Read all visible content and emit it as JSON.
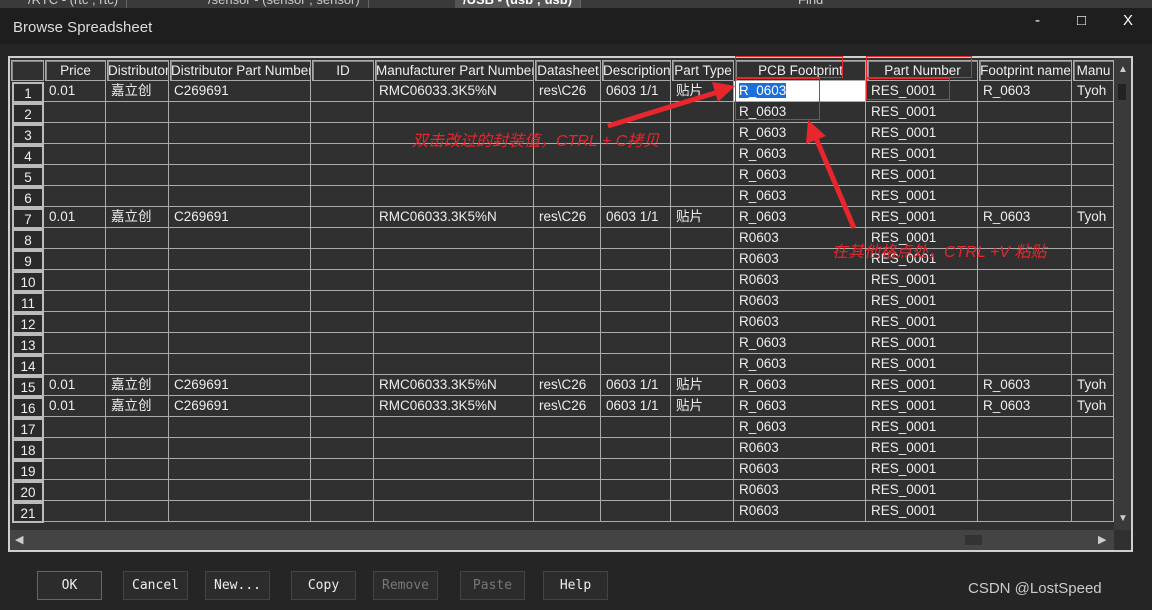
{
  "tabs": [
    "/RTC - (rtc ; rtc)",
    "/sensor - (sensor ; sensor)",
    "/USB - (usb ; usb)",
    "Find"
  ],
  "window": {
    "title": "Browse Spreadsheet",
    "minimize": "-",
    "maximize": "□",
    "close": "X"
  },
  "columns": [
    "",
    "Price",
    "Distributor",
    "Distributor Part Number",
    "ID",
    "Manufacturer Part Number",
    "Datasheet",
    "Description",
    "Part Type",
    "PCB Footprint",
    "Part Number",
    "Footprint name",
    "Manu"
  ],
  "rows": [
    [
      "1",
      "0.01",
      "嘉立创",
      "C269691",
      "",
      "RMC06033.3K5%N",
      "res\\C26",
      "0603 1/1",
      "贴片",
      "R_0603",
      "RES_0001",
      "R_0603",
      "Tyoh"
    ],
    [
      "2",
      "",
      "",
      "",
      "",
      "",
      "",
      "",
      "",
      "R_0603",
      "RES_0001",
      "",
      ""
    ],
    [
      "3",
      "",
      "",
      "",
      "",
      "",
      "",
      "",
      "",
      "R_0603",
      "RES_0001",
      "",
      ""
    ],
    [
      "4",
      "",
      "",
      "",
      "",
      "",
      "",
      "",
      "",
      "R_0603",
      "RES_0001",
      "",
      ""
    ],
    [
      "5",
      "",
      "",
      "",
      "",
      "",
      "",
      "",
      "",
      "R_0603",
      "RES_0001",
      "",
      ""
    ],
    [
      "6",
      "",
      "",
      "",
      "",
      "",
      "",
      "",
      "",
      "R_0603",
      "RES_0001",
      "",
      ""
    ],
    [
      "7",
      "0.01",
      "嘉立创",
      "C269691",
      "",
      "RMC06033.3K5%N",
      "res\\C26",
      "0603 1/1",
      "贴片",
      "R_0603",
      "RES_0001",
      "R_0603",
      "Tyoh"
    ],
    [
      "8",
      "",
      "",
      "",
      "",
      "",
      "",
      "",
      "",
      "R0603",
      "RES_0001",
      "",
      ""
    ],
    [
      "9",
      "",
      "",
      "",
      "",
      "",
      "",
      "",
      "",
      "R0603",
      "RES_0001",
      "",
      ""
    ],
    [
      "10",
      "",
      "",
      "",
      "",
      "",
      "",
      "",
      "",
      "R0603",
      "RES_0001",
      "",
      ""
    ],
    [
      "11",
      "",
      "",
      "",
      "",
      "",
      "",
      "",
      "",
      "R0603",
      "RES_0001",
      "",
      ""
    ],
    [
      "12",
      "",
      "",
      "",
      "",
      "",
      "",
      "",
      "",
      "R0603",
      "RES_0001",
      "",
      ""
    ],
    [
      "13",
      "",
      "",
      "",
      "",
      "",
      "",
      "",
      "",
      "R_0603",
      "RES_0001",
      "",
      ""
    ],
    [
      "14",
      "",
      "",
      "",
      "",
      "",
      "",
      "",
      "",
      "R_0603",
      "RES_0001",
      "",
      ""
    ],
    [
      "15",
      "0.01",
      "嘉立创",
      "C269691",
      "",
      "RMC06033.3K5%N",
      "res\\C26",
      "0603 1/1",
      "贴片",
      "R_0603",
      "RES_0001",
      "R_0603",
      "Tyoh"
    ],
    [
      "16",
      "0.01",
      "嘉立创",
      "C269691",
      "",
      "RMC06033.3K5%N",
      "res\\C26",
      "0603 1/1",
      "贴片",
      "R_0603",
      "RES_0001",
      "R_0603",
      "Tyoh"
    ],
    [
      "17",
      "",
      "",
      "",
      "",
      "",
      "",
      "",
      "",
      "R_0603",
      "RES_0001",
      "",
      ""
    ],
    [
      "18",
      "",
      "",
      "",
      "",
      "",
      "",
      "",
      "",
      "R0603",
      "RES_0001",
      "",
      ""
    ],
    [
      "19",
      "",
      "",
      "",
      "",
      "",
      "",
      "",
      "",
      "R0603",
      "RES_0001",
      "",
      ""
    ],
    [
      "20",
      "",
      "",
      "",
      "",
      "",
      "",
      "",
      "",
      "R0603",
      "RES_0001",
      "",
      ""
    ],
    [
      "21",
      "",
      "",
      "",
      "",
      "",
      "",
      "",
      "",
      "R0603",
      "RES_0001",
      "",
      ""
    ]
  ],
  "editing_cell": {
    "row": 1,
    "column": "PCB Footprint",
    "value": "R_0603"
  },
  "annotations": {
    "copy_note": "双击改过的封装值，CTRL + C拷贝",
    "paste_note": "在其他格点处，CTRL +V 粘贴",
    "color": "#e8262c"
  },
  "buttons": {
    "ok": "OK",
    "cancel": "Cancel",
    "new": "New...",
    "copy": "Copy",
    "remove": "Remove",
    "paste": "Paste",
    "help": "Help"
  },
  "watermark": "CSDN @LostSpeed"
}
